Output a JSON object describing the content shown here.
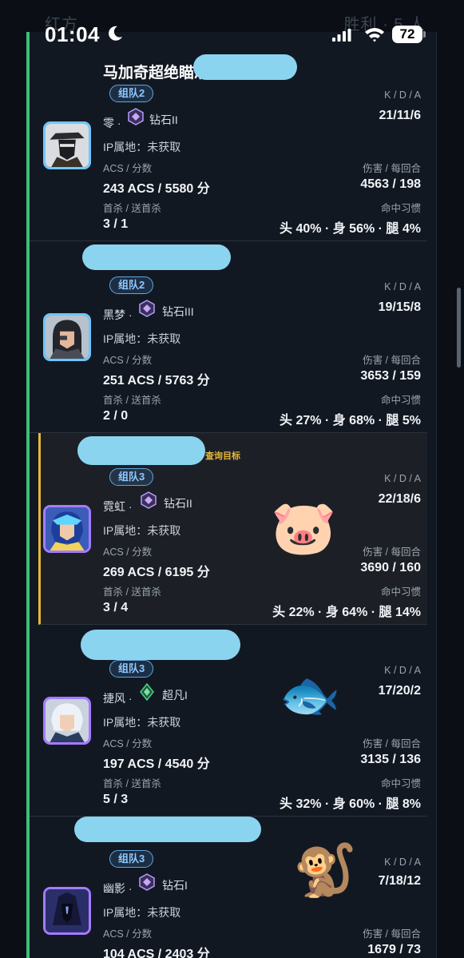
{
  "status": {
    "time": "01:04",
    "battery": "72",
    "bg_left": "红方",
    "bg_right": "胜利 · 5 人"
  },
  "labels": {
    "ip_prefix": "IP属地：",
    "acs_score": "ACS / 分数",
    "first_kills": "首杀 / 送首杀",
    "kda": "K / D / A",
    "damage": "伤害 / 每回合",
    "hit_habit": "命中习惯",
    "query_target": "查询目标"
  },
  "players": [
    {
      "name": "马加奇超绝瞄准",
      "group": "组队2",
      "agent": "零 ·",
      "rank": "钻石II",
      "ip": "IP属地：未获取",
      "acs": "243 ACS / 5580 分",
      "first": "3 / 1",
      "kda": "21/11/6",
      "damage": "4563 / 198",
      "hits": "头 40% · 身 56% · 腿 4%"
    },
    {
      "name": "",
      "group": "组队2",
      "agent": "黑梦 ·",
      "rank": "钻石III",
      "ip": "IP属地：未获取",
      "acs": "251 ACS / 5763 分",
      "first": "2 / 0",
      "kda": "19/15/8",
      "damage": "3653 / 159",
      "hits": "头 27% · 身 68% · 腿 5%"
    },
    {
      "name": "",
      "group": "组队3",
      "agent": "霓虹 ·",
      "rank": "钻石II",
      "ip": "IP属地：未获取",
      "acs": "269 ACS / 6195 分",
      "first": "3 / 4",
      "kda": "22/18/6",
      "damage": "3690 / 160",
      "hits": "头 22% · 身 64% · 腿 14%"
    },
    {
      "name": "",
      "group": "组队3",
      "agent": "捷风 ·",
      "rank": "超凡I",
      "ip": "IP属地：未获取",
      "acs": "197 ACS / 4540 分",
      "first": "5 / 3",
      "kda": "17/20/2",
      "damage": "3135 / 136",
      "hits": "头 32% · 身 60% · 腿 8%"
    },
    {
      "name": "",
      "group": "组队3",
      "agent": "幽影 ·",
      "rank": "钻石I",
      "ip": "IP属地：未获取",
      "acs": "104 ACS / 2403 分",
      "first": "",
      "kda": "7/18/12",
      "damage": "1679 / 73",
      "hits": ""
    }
  ],
  "emojis": {
    "pig": "🐷",
    "fish": "🐟",
    "monkey": "🐒"
  }
}
